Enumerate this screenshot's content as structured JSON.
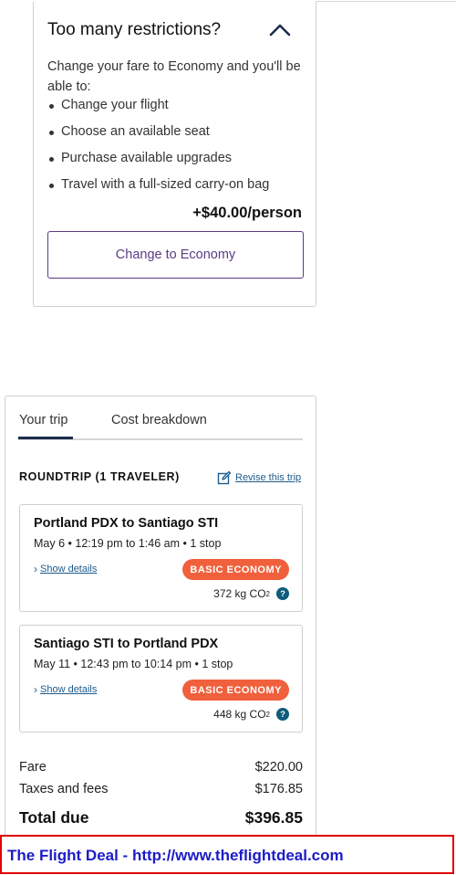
{
  "upsell": {
    "title": "Too many restrictions?",
    "intro": "Change your fare to Economy and you'll be able to:",
    "perks": [
      "Change your flight",
      "Choose an available seat",
      "Purchase available upgrades",
      "Travel with a full-sized carry-on bag"
    ],
    "price": "+$40.00/person",
    "button_label": "Change to Economy",
    "collapse_icon": "chevron-up-icon"
  },
  "trip": {
    "tabs": [
      "Your trip",
      "Cost breakdown"
    ],
    "active_tab": "Your trip",
    "roundtrip_label": "ROUNDTRIP (1 TRAVELER)",
    "revise_label": "Revise this trip",
    "revise_icon": "edit-icon",
    "flights": [
      {
        "route": "Portland PDX to Santiago STI",
        "times": "May 6 • 12:19 pm to 1:46 am • 1 stop",
        "details_label": "Show details",
        "badge": "BASIC ECONOMY",
        "co2_value": "372 kg CO",
        "co2_sub": "2",
        "help_icon": "?"
      },
      {
        "route": "Santiago STI to Portland PDX",
        "times": "May 11 • 12:43 pm to 10:14 pm • 1 stop",
        "details_label": "Show details",
        "badge": "BASIC ECONOMY",
        "co2_value": "448 kg CO",
        "co2_sub": "2",
        "help_icon": "?"
      }
    ],
    "fare_label": "Fare",
    "fare_value": "$220.00",
    "taxes_label": "Taxes and fees",
    "taxes_value": "$176.85",
    "total_label": "Total due",
    "total_value": "$396.85"
  },
  "banner": {
    "text": "The Flight Deal - http://www.theflightdeal.com"
  },
  "colors": {
    "accent_purple": "#5a3b86",
    "badge_orange": "#f0603c",
    "link_blue": "#1c5b8c",
    "banner_border": "#e00000",
    "banner_text": "#1c1cc8"
  }
}
